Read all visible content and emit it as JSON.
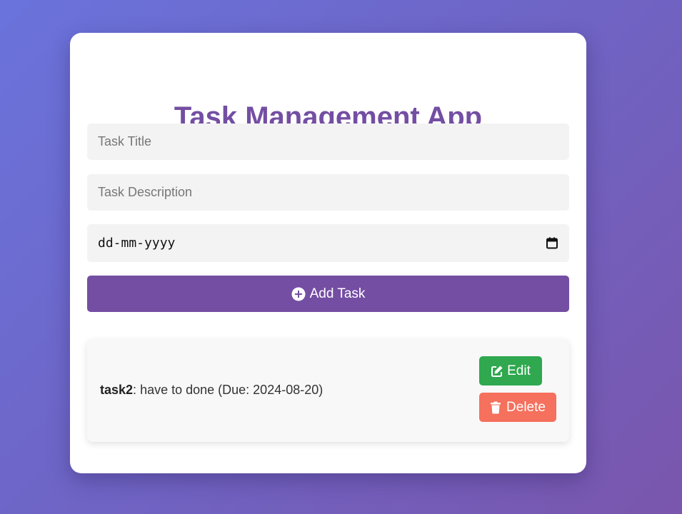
{
  "app": {
    "title": "Task Management App"
  },
  "form": {
    "title_placeholder": "Task Title",
    "title_value": "",
    "description_placeholder": "Task Description",
    "description_value": "",
    "date_placeholder": "dd-mm-yyyy",
    "date_icon": "calendar-icon",
    "add_button_label": "Add Task",
    "add_button_icon": "plus-circle-icon"
  },
  "tasks": [
    {
      "name": "task2",
      "separator": ": ",
      "details": "have to done (Due: 2024-08-20)",
      "edit_label": "Edit",
      "edit_icon": "edit-icon",
      "delete_label": "Delete",
      "delete_icon": "trash-icon"
    }
  ],
  "colors": {
    "accent": "#744ea3",
    "edit": "#2fa84f",
    "delete": "#f5705d",
    "background_start": "#6a73dc",
    "background_end": "#7a56ad"
  }
}
